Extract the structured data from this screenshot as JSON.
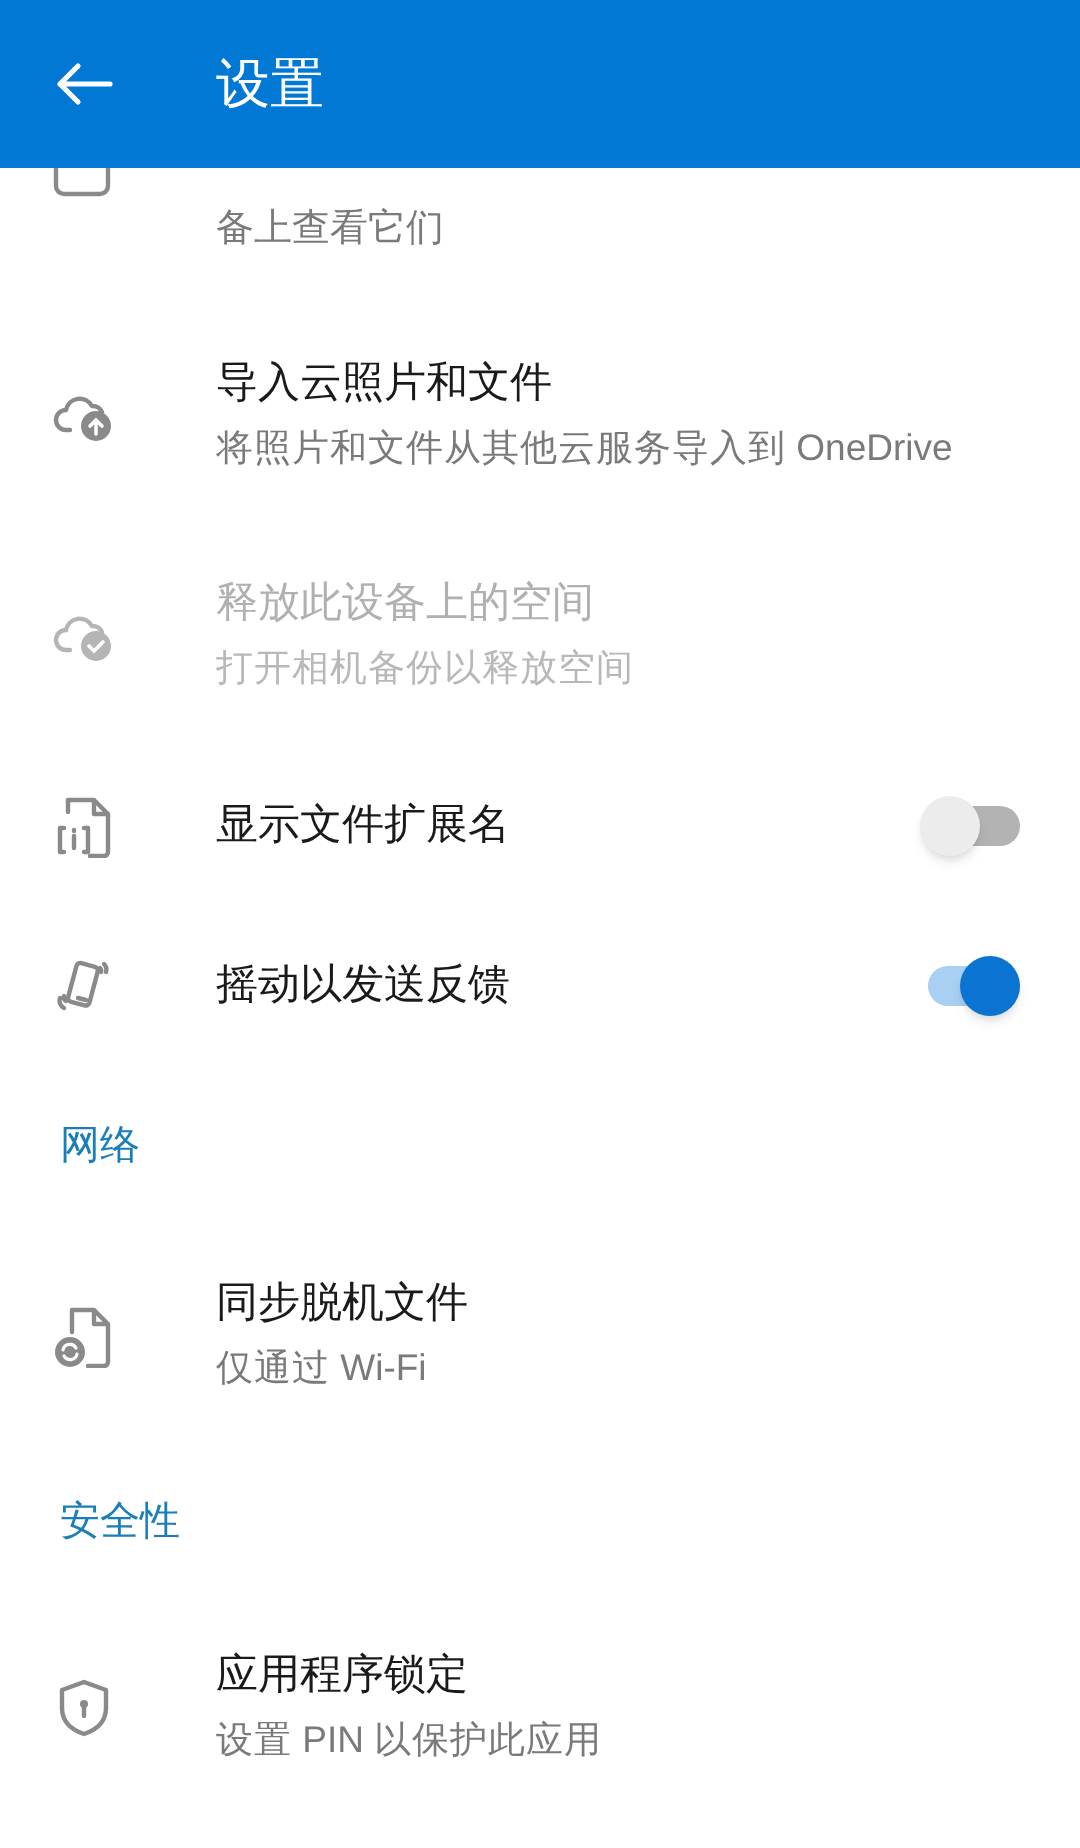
{
  "header": {
    "title": "设置"
  },
  "items": [
    {
      "kind": "description",
      "text": "备上查看它们"
    },
    {
      "kind": "item",
      "title": "导入云照片和文件",
      "subtitle": "将照片和文件从其他云服务导入到 OneDrive",
      "disabled": false
    },
    {
      "kind": "item",
      "title": "释放此设备上的空间",
      "subtitle": "打开相机备份以释放空间",
      "disabled": true
    },
    {
      "kind": "toggle",
      "title": "显示文件扩展名",
      "on": false
    },
    {
      "kind": "toggle",
      "title": "摇动以发送反馈",
      "on": true
    },
    {
      "kind": "section",
      "title": "网络"
    },
    {
      "kind": "item",
      "title": "同步脱机文件",
      "subtitle": "仅通过 Wi-Fi",
      "disabled": false
    },
    {
      "kind": "section",
      "title": "安全性"
    },
    {
      "kind": "item",
      "title": "应用程序锁定",
      "subtitle": "设置 PIN 以保护此应用",
      "disabled": false
    }
  ]
}
